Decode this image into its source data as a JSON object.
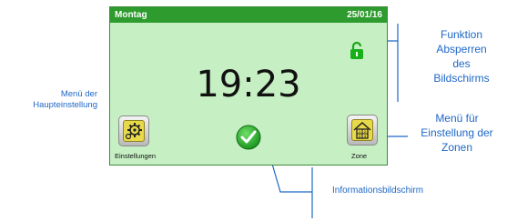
{
  "screen": {
    "day": "Montag",
    "date": "25/01/16",
    "time": "19:23",
    "settings_label": "Einstellungen",
    "zone_label": "Zone",
    "zone_icon_text": "1|2\n3|4"
  },
  "annotations": {
    "lock_function": [
      "Funktion",
      "Absperren",
      "des",
      "Bildschirms"
    ],
    "main_settings_menu": [
      "Menü der",
      "Haupteinstellung"
    ],
    "zone_settings_menu": [
      "Menü für",
      "Einstellung der",
      "Zonen"
    ],
    "info_screen": "Informationsbildschirm"
  },
  "colors": {
    "screen_bg": "#c6efc3",
    "topbar": "#2e9b2e",
    "annotation_text": "#1f67c7",
    "icon_accent": "#e7d94a"
  },
  "icons": [
    "padlock-open-icon",
    "gear-icon",
    "checkmark-icon",
    "house-zone-icon"
  ]
}
